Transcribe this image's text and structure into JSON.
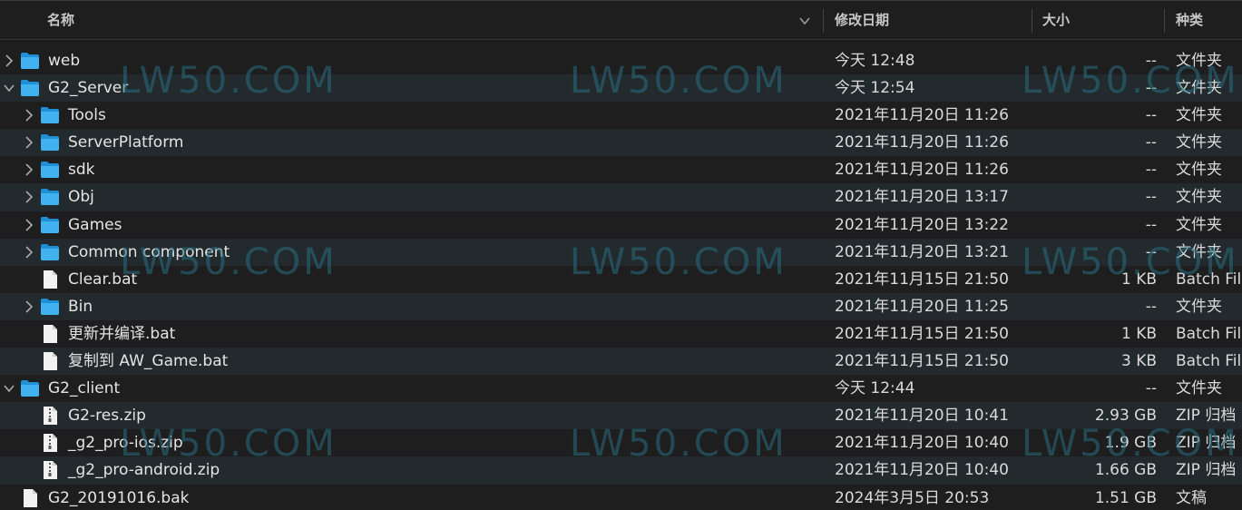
{
  "columns": {
    "name": "名称",
    "modified": "修改日期",
    "size": "大小",
    "kind": "种类"
  },
  "watermark": "LW50.COM",
  "rows": [
    {
      "name": "web",
      "modified": "今天 12:48",
      "size": "--",
      "kind": "文件夹",
      "type": "folder",
      "level": 0,
      "disclosure": "collapsed"
    },
    {
      "name": "G2_Server",
      "modified": "今天 12:54",
      "size": "--",
      "kind": "文件夹",
      "type": "folder",
      "level": 0,
      "disclosure": "expanded"
    },
    {
      "name": "Tools",
      "modified": "2021年11月20日 11:26",
      "size": "--",
      "kind": "文件夹",
      "type": "folder",
      "level": 1,
      "disclosure": "collapsed"
    },
    {
      "name": "ServerPlatform",
      "modified": "2021年11月20日 11:26",
      "size": "--",
      "kind": "文件夹",
      "type": "folder",
      "level": 1,
      "disclosure": "collapsed"
    },
    {
      "name": "sdk",
      "modified": "2021年11月20日 11:26",
      "size": "--",
      "kind": "文件夹",
      "type": "folder",
      "level": 1,
      "disclosure": "collapsed"
    },
    {
      "name": "Obj",
      "modified": "2021年11月20日 13:17",
      "size": "--",
      "kind": "文件夹",
      "type": "folder",
      "level": 1,
      "disclosure": "collapsed"
    },
    {
      "name": "Games",
      "modified": "2021年11月20日 13:22",
      "size": "--",
      "kind": "文件夹",
      "type": "folder",
      "level": 1,
      "disclosure": "collapsed"
    },
    {
      "name": "Common component",
      "modified": "2021年11月20日 13:21",
      "size": "--",
      "kind": "文件夹",
      "type": "folder",
      "level": 1,
      "disclosure": "collapsed"
    },
    {
      "name": "Clear.bat",
      "modified": "2021年11月15日 21:50",
      "size": "1 KB",
      "kind": "Batch Fil",
      "type": "file",
      "level": 1,
      "disclosure": "none"
    },
    {
      "name": "Bin",
      "modified": "2021年11月20日 11:25",
      "size": "--",
      "kind": "文件夹",
      "type": "folder",
      "level": 1,
      "disclosure": "collapsed"
    },
    {
      "name": "更新并编译.bat",
      "modified": "2021年11月15日 21:50",
      "size": "1 KB",
      "kind": "Batch Fil",
      "type": "file",
      "level": 1,
      "disclosure": "none"
    },
    {
      "name": "复制到 AW_Game.bat",
      "modified": "2021年11月15日 21:50",
      "size": "3 KB",
      "kind": "Batch Fil",
      "type": "file",
      "level": 1,
      "disclosure": "none"
    },
    {
      "name": "G2_client",
      "modified": "今天 12:44",
      "size": "--",
      "kind": "文件夹",
      "type": "folder",
      "level": 0,
      "disclosure": "expanded"
    },
    {
      "name": "G2-res.zip",
      "modified": "2021年11月20日 10:41",
      "size": "2.93 GB",
      "kind": "ZIP 归档",
      "type": "zip",
      "level": 1,
      "disclosure": "none"
    },
    {
      "name": "_g2_pro-ios.zip",
      "modified": "2021年11月20日 10:40",
      "size": "1.9 GB",
      "kind": "ZIP 归档",
      "type": "zip",
      "level": 1,
      "disclosure": "none"
    },
    {
      "name": "_g2_pro-android.zip",
      "modified": "2021年11月20日 10:40",
      "size": "1.66 GB",
      "kind": "ZIP 归档",
      "type": "zip",
      "level": 1,
      "disclosure": "none"
    },
    {
      "name": "G2_20191016.bak",
      "modified": "2024年3月5日 20:53",
      "size": "1.51 GB",
      "kind": "文稿",
      "type": "file",
      "level": 0,
      "disclosure": "none"
    }
  ]
}
